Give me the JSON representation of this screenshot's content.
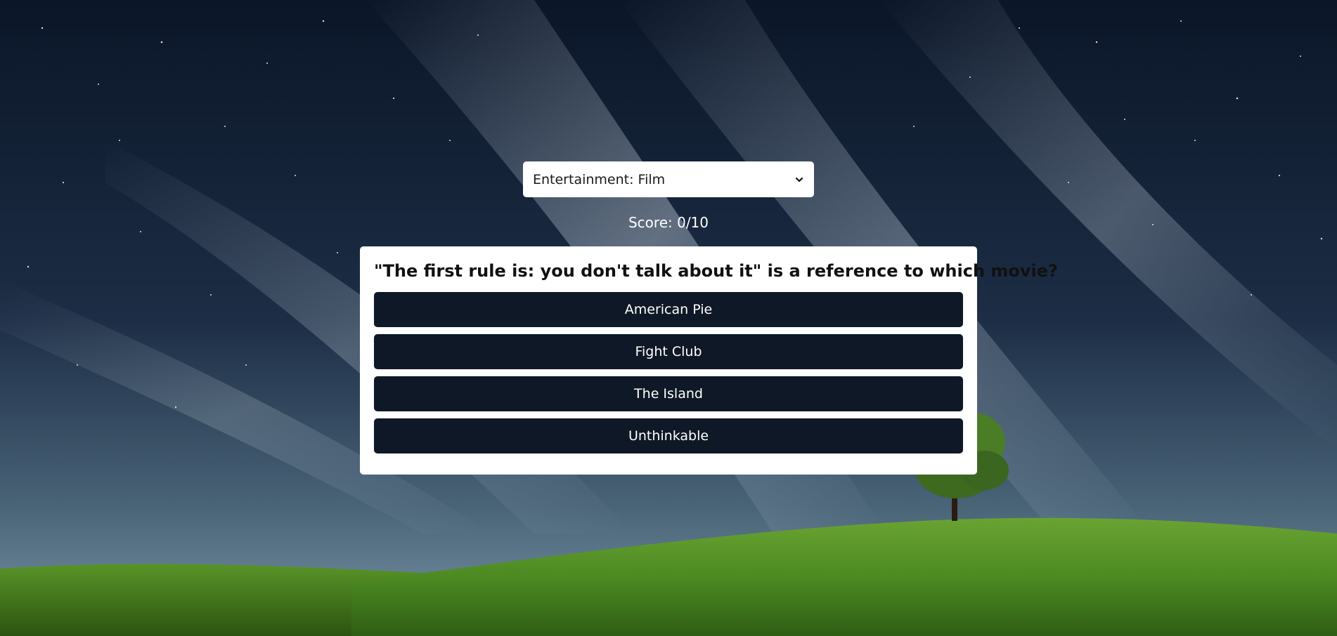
{
  "category": {
    "selected": "Entertainment: Film"
  },
  "score": {
    "text": "Score: 0/10"
  },
  "question": {
    "text": "\"The first rule is: you don't talk about it\" is a reference to which movie?"
  },
  "answers": [
    {
      "label": "American Pie"
    },
    {
      "label": "Fight Club"
    },
    {
      "label": "The Island"
    },
    {
      "label": "Unthinkable"
    }
  ],
  "colors": {
    "button_bg": "#0f1826",
    "card_bg": "#ffffff",
    "score_text": "#ffffff"
  }
}
